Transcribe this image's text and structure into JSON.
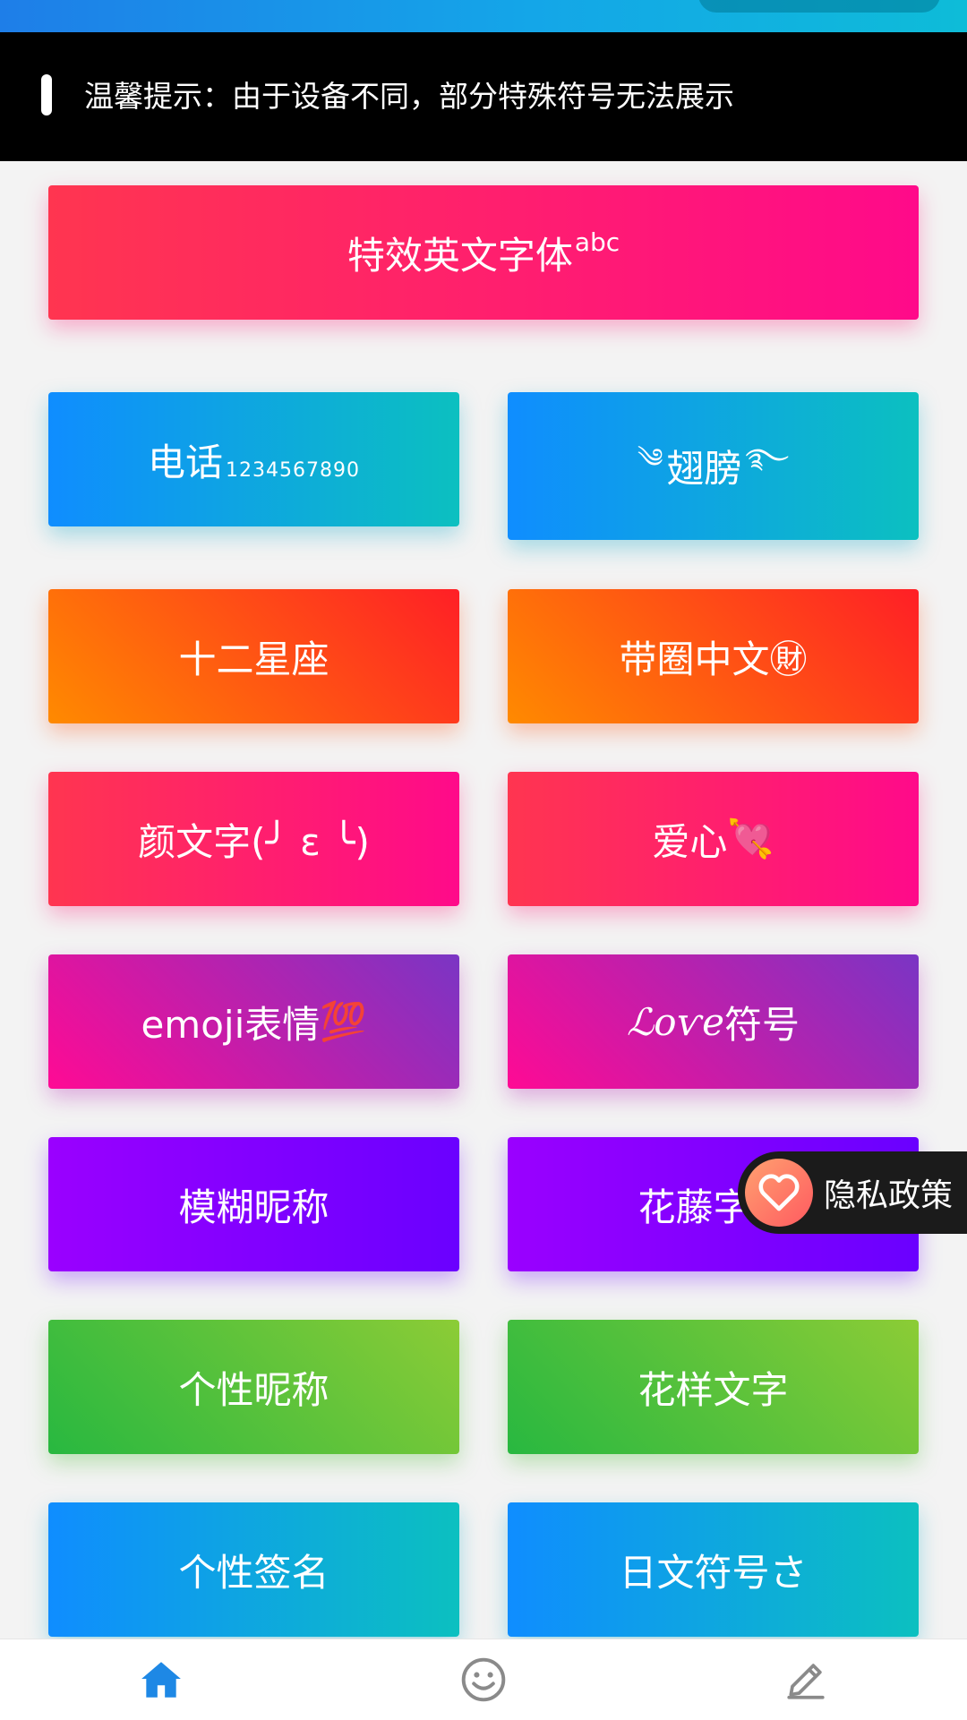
{
  "notice": {
    "text": "温馨提示：由于设备不同，部分特殊符号无法展示"
  },
  "buttons": {
    "fancy_english": {
      "label": "特效英文字体",
      "suffix": "abc"
    },
    "phone": {
      "label": "电话",
      "sub": "1234567890"
    },
    "wings": {
      "left_deco": "༄",
      "label": "翅膀",
      "right_deco": "࿐"
    },
    "zodiac": {
      "label": "十二星座"
    },
    "circled_chinese": {
      "label": "带圈中文㊖"
    },
    "kaomoji": {
      "label": "颜文字(╯ ε ╰)"
    },
    "love_heart": {
      "label": "爱心",
      "emoji": "💘"
    },
    "emoji": {
      "label": "emoji表情",
      "emoji": "💯"
    },
    "love_symbols": {
      "script": "ℒoѵe",
      "label": "符号"
    },
    "blur_nickname": {
      "label": "模糊昵称"
    },
    "vine_text": {
      "label": "花藤字体"
    },
    "personal_nickname": {
      "label": "个性昵称"
    },
    "fancy_text": {
      "label": "花样文字"
    },
    "personal_signature": {
      "label": "个性签名"
    },
    "japanese_symbols": {
      "label": "日文符号さ"
    }
  },
  "privacy": {
    "label": "隐私政策"
  },
  "bottom_nav": {
    "items": [
      {
        "icon": "home-icon",
        "active": true
      },
      {
        "icon": "smiley-icon",
        "active": false
      },
      {
        "icon": "pencil-icon",
        "active": false
      }
    ],
    "active_color": "#1e88e5",
    "inactive_color": "#8a8a8a"
  }
}
